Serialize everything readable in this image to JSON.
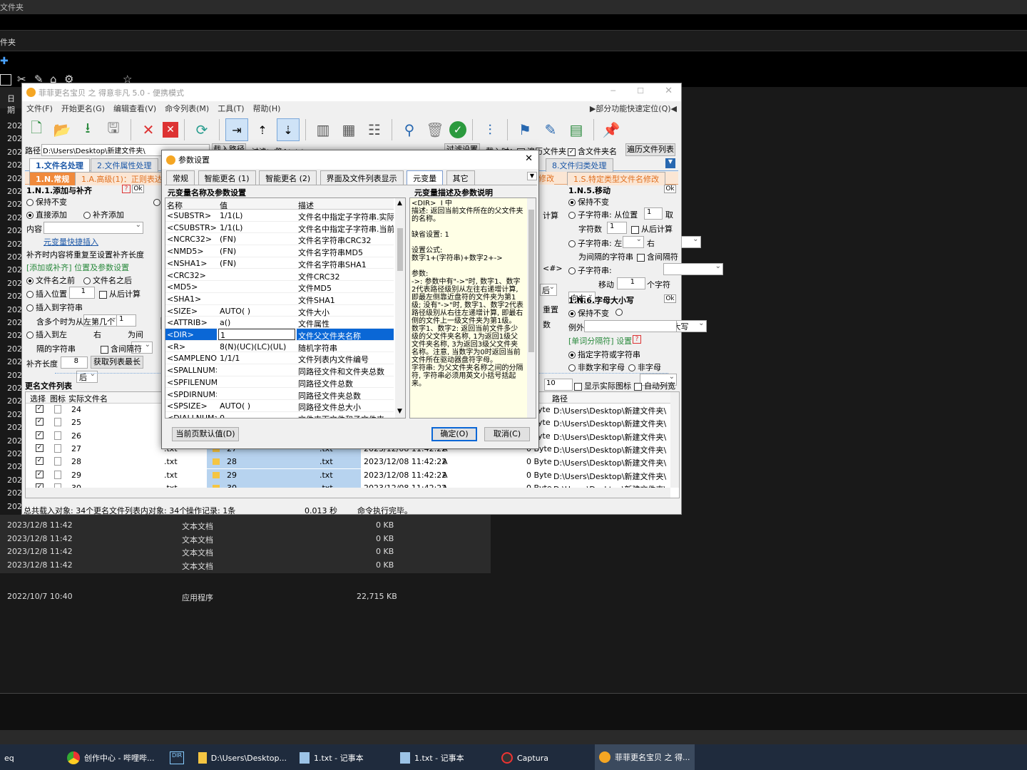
{
  "background": {
    "title_fragment": "文件夹",
    "bar2_fragment": "件夹",
    "date_col_header": "日期",
    "left_years": [
      "202",
      "202",
      "202",
      "202",
      "202",
      "202",
      "202",
      "202",
      "202",
      "202",
      "202",
      "202",
      "202",
      "202",
      "202",
      "202",
      "202",
      "202",
      "202",
      "202",
      "202",
      "202",
      "202",
      "202",
      "202",
      "202",
      "202",
      "202",
      "202",
      "202"
    ],
    "rows": [
      {
        "date": "2023/12/8 11:42",
        "type": "文本文档",
        "size": "0 KB"
      },
      {
        "date": "2023/12/8 11:42",
        "type": "文本文档",
        "size": "0 KB"
      },
      {
        "date": "2023/12/8 11:42",
        "type": "文本文档",
        "size": "0 KB"
      },
      {
        "date": "2023/12/8 11:42",
        "type": "文本文档",
        "size": "0 KB"
      }
    ],
    "app_row": {
      "date": "2022/10/7 10:40",
      "type": "应用程序",
      "size": "22,715 KB"
    }
  },
  "taskbar": {
    "items": [
      {
        "label": "eq"
      },
      {
        "label": "创作中心 - 哔哩哔..."
      },
      {
        "label": ""
      },
      {
        "label": "D:\\Users\\Desktop..."
      },
      {
        "label": "1.txt - 记事本"
      },
      {
        "label": "1.txt - 记事本"
      },
      {
        "label": "Captura"
      },
      {
        "label": "菲菲更名宝贝 之 得..."
      }
    ]
  },
  "app": {
    "title": "菲菲更名宝贝 之 得意非凡 5.0 - 便携模式",
    "menu": [
      "文件(F)",
      "开始更名(G)",
      "编辑查看(V)",
      "命令列表(M)",
      "工具(T)",
      "帮助(H)"
    ],
    "quick_locate": "▶部分功能快速定位(Q)◀",
    "path_label": "路径",
    "path_value": "D:\\Users\\Desktop\\新建文件夹\\",
    "filter_label": "过滤：/隐A：*.*",
    "buttons_row": {
      "load_path": "载入路径",
      "filter_set": "过滤设置",
      "load_time": "载入时：",
      "traverse": "遍历文件夹",
      "include_folder": "含文件夹名",
      "traverse_list": "遍历文件列表"
    },
    "main_tabs": [
      "1.文件名处理",
      "2.文件属性处理",
      "8.文件归类处理"
    ],
    "sub_tabs": [
      "1.N.常规",
      "1.A.高级(1)：正则表达式",
      "修改",
      "1.S.特定类型文件名修改"
    ],
    "left_panel": {
      "title": "1.N.1.添加与补齐",
      "keep": "保持不变",
      "direct_add": "直接添加",
      "fill_add": "补齐添加",
      "content": "内容",
      "metavar_insert": "元变量快捷插入",
      "fill_note": "补齐时内容将重复至设置补齐长度",
      "pos_title": "[添加或补齐] 位置及参数设置",
      "before_name": "文件名之前",
      "after_name": "文件名之后",
      "insert_pos": "插入位置",
      "insert_pos_val": "1",
      "from_end": "从后计算",
      "insert_to_str": "插入到字符串",
      "after": "后",
      "multi_left": "含多个时为从左第几个",
      "multi_val": "1",
      "insert_left": "插入到左",
      "right": "右",
      "between": "为间",
      "sep_str": "隔的字符串",
      "contains_sep": "含间隔符",
      "fill_length": "补齐长度",
      "fill_val": "8",
      "get_max": "获取列表最长"
    },
    "right_panel": {
      "title": "1.N.5.移动",
      "keep": "保持不变",
      "substr": "子字符串: 从位置",
      "from_val": "1",
      "take": "取",
      "char_count": "字符数",
      "count_val": "1",
      "from_end": "从后计算",
      "substr_left": "子字符串: 左",
      "right": "右",
      "between_str": "为间隔的字符串",
      "contains_sep": "含间隔符",
      "substr2": "子字符串:",
      "direction": "向右",
      "move": "移动",
      "move_val": "1",
      "chars": "个字符",
      "case_title": "1.N.6.字母大小写",
      "case_keep": "保持不变",
      "all_upper": "全部大写",
      "exception": "例外",
      "word_sep": "[单词分隔符] 设置",
      "spec_char": "指定字符或字符串",
      "non_alnum": "非数字和字母",
      "non_alpha": "非字母",
      "show_icon": "显示实际图标",
      "auto_width": "自动列宽",
      "ten": "10",
      "path_col": "路径"
    },
    "mid_fragments": {
      "label_r": "计算",
      "label_hou": "后",
      "label_chongzhi": "重置",
      "label_shu": "数",
      "label_var": "<#>"
    },
    "rename_list": {
      "title": "更名文件列表",
      "headers": [
        "选择",
        "图标",
        "实际文件名"
      ],
      "rows": [
        {
          "name": "24",
          "ext": "",
          "new": "",
          "next": "",
          "time": "",
          "attr": "",
          "size": "",
          "path": "D:\\Users\\Desktop\\新建文件夹\\"
        },
        {
          "name": "25",
          "ext": "",
          "new": "",
          "next": "",
          "time": "",
          "attr": "",
          "size": "",
          "path": "D:\\Users\\Desktop\\新建文件夹\\"
        },
        {
          "name": "26",
          "ext": "",
          "new": "",
          "next": "",
          "time": "",
          "attr": "",
          "size": "",
          "path": "D:\\Users\\Desktop\\新建文件夹\\"
        },
        {
          "name": "27",
          "ext": ".txt",
          "new": "27",
          "next": ".txt",
          "time": "2023/12/08 11:42:22",
          "attr": "A",
          "size": "0 Byte",
          "path": "D:\\Users\\Desktop\\新建文件夹\\"
        },
        {
          "name": "28",
          "ext": ".txt",
          "new": "28",
          "next": ".txt",
          "time": "2023/12/08 11:42:22",
          "attr": "A",
          "size": "0 Byte",
          "path": "D:\\Users\\Desktop\\新建文件夹\\"
        },
        {
          "name": "29",
          "ext": ".txt",
          "new": "29",
          "next": ".txt",
          "time": "2023/12/08 11:42:22",
          "attr": "A",
          "size": "0 Byte",
          "path": "D:\\Users\\Desktop\\新建文件夹\\"
        },
        {
          "name": "30",
          "ext": ".txt",
          "new": "30",
          "next": ".txt",
          "time": "2023/12/08 11:42:22",
          "attr": "A",
          "size": "0 Byte",
          "path": "D:\\Users\\Desktop\\新建文件夹\\"
        }
      ],
      "byte_prefix": "yte"
    },
    "status": {
      "loaded": "总共载入对象: 34个",
      "rename_count": "更名文件列表内对象: 34个",
      "ops": "操作记录: 1条",
      "time": "0.013 秒",
      "msg": "命令执行完毕。"
    }
  },
  "dialog": {
    "title": "参数设置",
    "tabs": [
      "常规",
      "智能更名 (1)",
      "智能更名 (2)",
      "界面及文件列表显示",
      "元变量",
      "其它"
    ],
    "grid_title": "元变量名称及参数设置",
    "desc_title": "元变量描述及参数说明",
    "headers": [
      "名称",
      "值",
      "描述"
    ],
    "rows": [
      {
        "name": "<SUBSTR>",
        "value": "1/1(L)",
        "desc": "文件名中指定子字符串.实际"
      },
      {
        "name": "<CSUBSTR>",
        "value": "1/1(L)",
        "desc": "文件名中指定子字符串.当前"
      },
      {
        "name": "<NCRC32>",
        "value": "(FN)",
        "desc": "文件名字符串CRC32"
      },
      {
        "name": "<NMD5>",
        "value": "(FN)",
        "desc": "文件名字符串MD5"
      },
      {
        "name": "<NSHA1>",
        "value": "(FN)",
        "desc": "文件名字符串SHA1"
      },
      {
        "name": "<CRC32>",
        "value": "",
        "desc": "文件CRC32"
      },
      {
        "name": "<MD5>",
        "value": "",
        "desc": "文件MD5"
      },
      {
        "name": "<SHA1>",
        "value": "",
        "desc": "文件SHA1"
      },
      {
        "name": "<SIZE>",
        "value": "AUTO( )",
        "desc": "文件大小"
      },
      {
        "name": "<ATTRIB>",
        "value": "a()",
        "desc": "文件属性"
      },
      {
        "name": "<DIR>",
        "value": "1",
        "desc": "文件父文件夹名称"
      },
      {
        "name": "<R>",
        "value": "8(N)(UC)(LC)(UL)",
        "desc": "随机字符串"
      },
      {
        "name": "<SAMPLENO>",
        "value": "1/1/1",
        "desc": "文件列表内文件编号"
      },
      {
        "name": "<SPALLNUM>",
        "value": "",
        "desc": "同路径文件和文件夹总数"
      },
      {
        "name": "<SPFILENUM>",
        "value": "",
        "desc": "同路径文件总数"
      },
      {
        "name": "<SPDIRNUM>",
        "value": "",
        "desc": "同路径文件夹总数"
      },
      {
        "name": "<SPSIZE>",
        "value": "AUTO( )",
        "desc": "同路径文件总大小"
      },
      {
        "name": "<DIALLNUM>",
        "value": "0",
        "desc": "文件夹下文件和子文件夹"
      }
    ],
    "desc_text": "<DIR>  I 中\n描述: 返回当前文件所在的父文件夹的名称。\n\n缺省设置: 1\n\n设置公式:\n数字1+(字符串)+数字2+->\n\n参数:\n->: 参数中有\"->\"时, 数字1、数字2代表路径级别从左往右递增计算, 即最左侧靠近盘符的文件夹为第1级; 没有\"->\"时, 数字1、数字2代表路径级别从右往左递增计算, 即最右侧的文件上一级文件夹为第1级。\n数字1、数字2: 返回当前文件多少级的父文件夹名称, 1为返回1级父文件夹名称, 3为返回3级父文件夹名称。注意, 当数字为0时返回当前文件所在驱动器盘符字母。\n字符串: 为父文件夹名称之间的分隔符, 字符串必须用英文小括号括起来。",
    "default_button": "当前页默认值(D)",
    "ok": "确定(O)",
    "cancel": "取消(C)"
  }
}
